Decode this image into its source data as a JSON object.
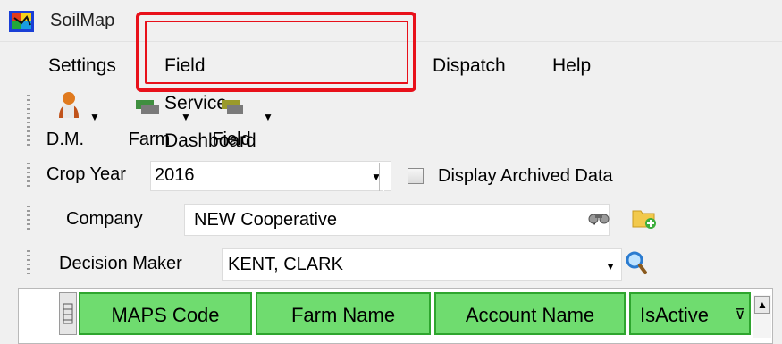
{
  "window": {
    "title": "SoilMap"
  },
  "menu": {
    "items": [
      {
        "label": "Settings"
      },
      {
        "label": "Field Service Dashboard"
      },
      {
        "label": "Dispatch"
      },
      {
        "label": "Help"
      }
    ]
  },
  "toolbar": {
    "buttons": [
      {
        "label": "D.M.",
        "icon": "person-icon"
      },
      {
        "label": "Farm",
        "icon": "farm-icon"
      },
      {
        "label": "Field",
        "icon": "field-icon"
      }
    ]
  },
  "crop_year": {
    "label": "Crop Year",
    "value": "2016"
  },
  "archived": {
    "label": "Display Archived Data",
    "checked": false
  },
  "company": {
    "label": "Company",
    "value": "NEW Cooperative"
  },
  "decision_maker": {
    "label": "Decision Maker",
    "value": "KENT, CLARK"
  },
  "grid": {
    "columns": [
      "MAPS Code",
      "Farm Name",
      "Account Name",
      "IsActive"
    ]
  },
  "colors": {
    "highlight": "#e8101a",
    "grid_header": "#6fdc6f"
  }
}
